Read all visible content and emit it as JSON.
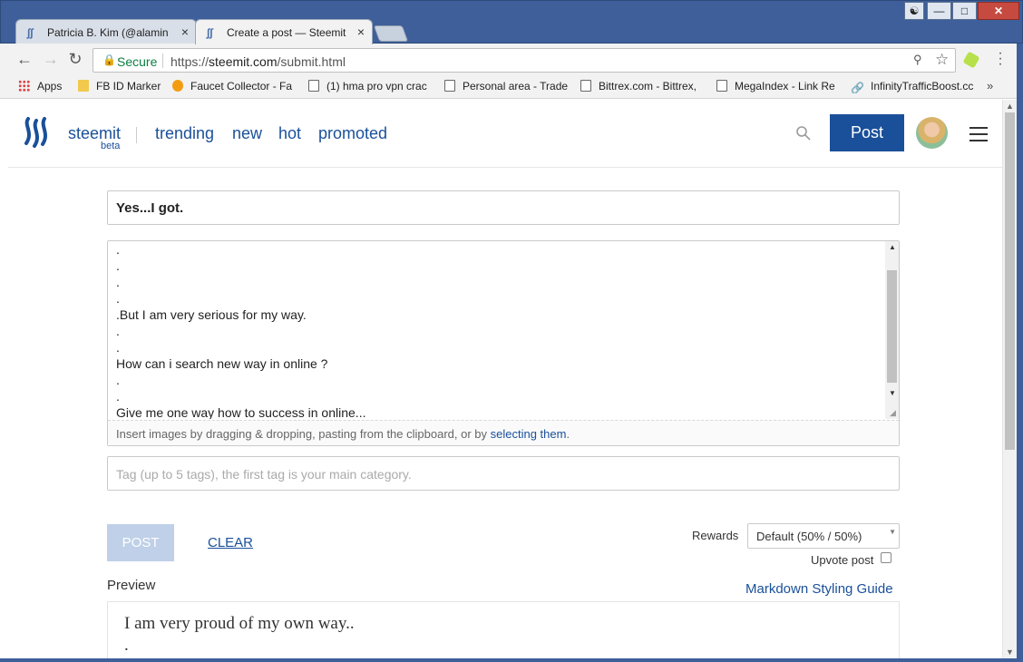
{
  "browser": {
    "tabs": [
      {
        "label": "Patricia B. Kim (@alamin",
        "active": false
      },
      {
        "label": "Create a post — Steemit",
        "active": true
      }
    ],
    "secure_label": "Secure",
    "url_scheme": "https://",
    "url_host": "steemit.com",
    "url_path": "/submit.html",
    "bookmarks": [
      {
        "label": "Apps",
        "icon": "apps-grid-icon"
      },
      {
        "label": "FB ID Marker",
        "icon": "folder-icon"
      },
      {
        "label": "Faucet Collector - Fa",
        "icon": "bitcoin-icon"
      },
      {
        "label": "(1) hma pro vpn crac",
        "icon": "page-icon"
      },
      {
        "label": "Personal area - Trade",
        "icon": "page-icon"
      },
      {
        "label": "Bittrex.com - Bittrex,",
        "icon": "page-icon"
      },
      {
        "label": "MegaIndex - Link Re",
        "icon": "page-icon"
      },
      {
        "label": "InfinityTrafficBoost.cc",
        "icon": "link-icon"
      }
    ],
    "bookmarks_overflow": "»"
  },
  "header": {
    "brand": "steemit",
    "brand_sub": "beta",
    "nav": [
      "trending",
      "new",
      "hot",
      "promoted"
    ],
    "post_button": "Post"
  },
  "editor": {
    "title_value": "Yes...I got.",
    "body_lines": [
      ".",
      ".",
      ".",
      ".",
      ".But I am very serious for my way.",
      ".",
      ".",
      "How can i search new way in online ?",
      ".",
      ".",
      "Give me one way how to success in online..."
    ],
    "dropzone_prefix": "Insert images by dragging & dropping, pasting from the clipboard, or by ",
    "dropzone_link": "selecting them",
    "dropzone_suffix": ".",
    "tags_placeholder": "Tag (up to 5 tags), the first tag is your main category."
  },
  "actions": {
    "submit_label": "POST",
    "clear_label": "CLEAR",
    "rewards_label": "Rewards",
    "rewards_value": "Default (50% / 50%)",
    "upvote_label": "Upvote post",
    "upvote_checked": false
  },
  "preview": {
    "label": "Preview",
    "guide_link": "Markdown Styling Guide",
    "lines": [
      "I am very proud of my own way..",
      "."
    ]
  },
  "colors": {
    "brand_blue": "#1a5099",
    "secure_green": "#0b8043"
  }
}
